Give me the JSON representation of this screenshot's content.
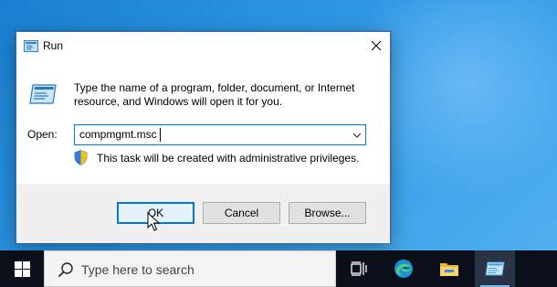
{
  "dialog": {
    "title": "Run",
    "description": "Type the name of a program, folder, document, or Internet resource, and Windows will open it for you.",
    "open_label": "Open:",
    "open_value": "compmgmt.msc",
    "admin_note": "This task will be created with administrative privileges.",
    "buttons": {
      "ok": "OK",
      "cancel": "Cancel",
      "browse": "Browse..."
    },
    "icons": {
      "title": "run-icon",
      "close": "close-icon",
      "dropdown": "chevron-down-icon",
      "shield": "uac-shield-icon"
    }
  },
  "taskbar": {
    "search_placeholder": "Type here to search",
    "icons": [
      "windows-start-icon",
      "search-icon",
      "task-view-icon",
      "edge-icon",
      "file-explorer-icon",
      "run-icon"
    ]
  },
  "colors": {
    "accent": "#0078d7",
    "taskbar": "#0b0f1a",
    "desktop": "#2c95e3"
  }
}
